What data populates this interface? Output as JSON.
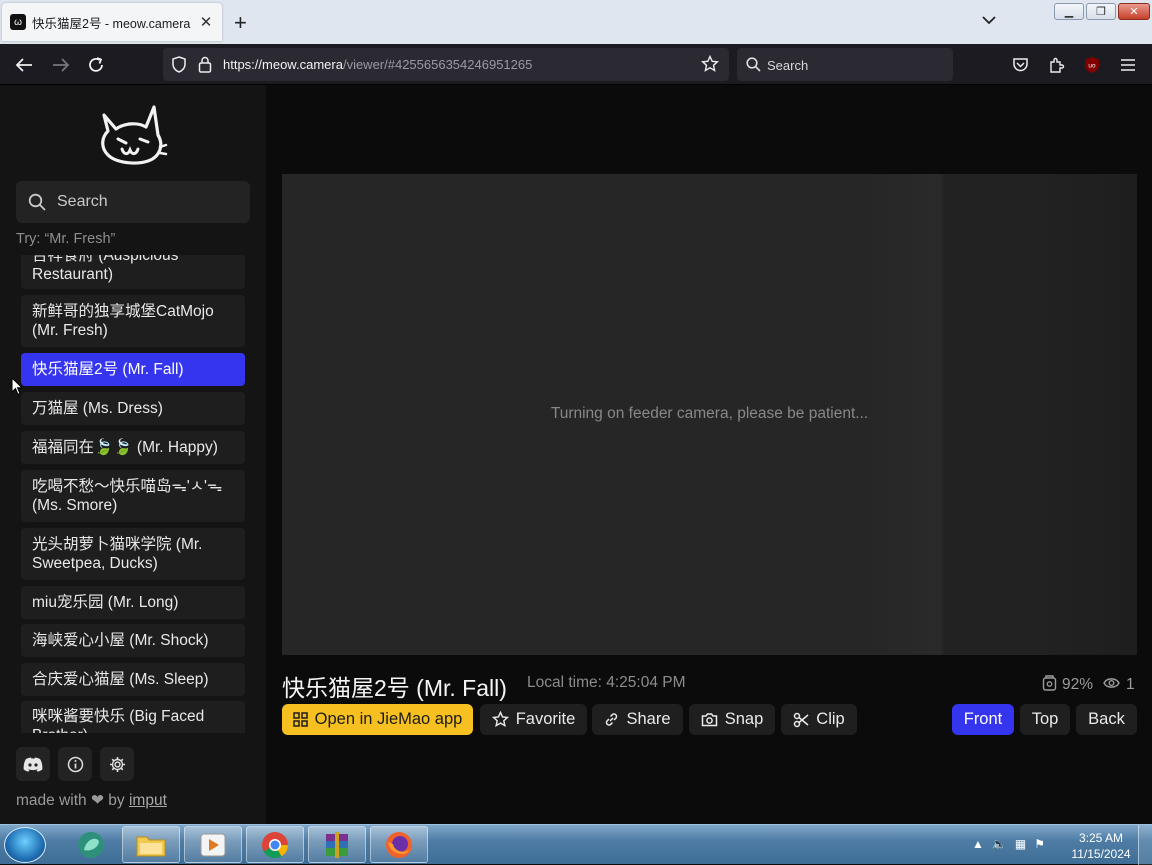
{
  "browser": {
    "tab_title": "快乐猫屋2号 - meow.camera",
    "url_host": "https://meow.camera",
    "url_path": "/viewer/#4255656354246951265",
    "search_placeholder": "Search"
  },
  "taskbar": {
    "time": "3:25 AM",
    "date": "11/15/2024"
  },
  "sidebar": {
    "search_placeholder": "Search",
    "try_hint": "Try: “Mr. Fresh”",
    "cameras": [
      {
        "label": "吉祥食府 (Auspicious Restaurant)",
        "active": false
      },
      {
        "label": "新鲜哥的独享城堡CatMojo (Mr. Fresh)",
        "active": false
      },
      {
        "label": "快乐猫屋2号 (Mr. Fall)",
        "active": true
      },
      {
        "label": "万猫屋 (Ms. Dress)",
        "active": false
      },
      {
        "label": "福福同在🍃🍃 (Mr. Happy)",
        "active": false
      },
      {
        "label": "吃喝不愁～快乐喵岛ᯓ'ㅅ'ᯓ (Ms. Smore)",
        "active": false
      },
      {
        "label": "光头胡萝卜猫咪学院 (Mr. Sweetpea, Ducks)",
        "active": false
      },
      {
        "label": "miu宠乐园 (Mr. Long)",
        "active": false
      },
      {
        "label": "海峡爱心小屋 (Mr. Shock)",
        "active": false
      },
      {
        "label": "合庆爱心猫屋 (Ms. Sleep)",
        "active": false
      },
      {
        "label": "咪咪酱要快乐 (Big Faced Brother)",
        "active": false
      }
    ],
    "footer": {
      "prefix": "made with",
      "by": "by",
      "author": "imput"
    }
  },
  "viewer": {
    "status_message": "Turning on feeder camera, please be patient...",
    "title": "快乐猫屋2号 (Mr. Fall)",
    "local_time": "Local time: 4:25:04 PM",
    "battery": "92%",
    "viewers": "1",
    "actions": {
      "open_app": "Open in JieMao app",
      "favorite": "Favorite",
      "share": "Share",
      "snap": "Snap",
      "clip": "Clip"
    },
    "views": {
      "front": "Front",
      "top": "Top",
      "back": "Back",
      "selected": "Front"
    }
  },
  "colors": {
    "accent": "#3535f0",
    "app_button": "#f6c021"
  }
}
